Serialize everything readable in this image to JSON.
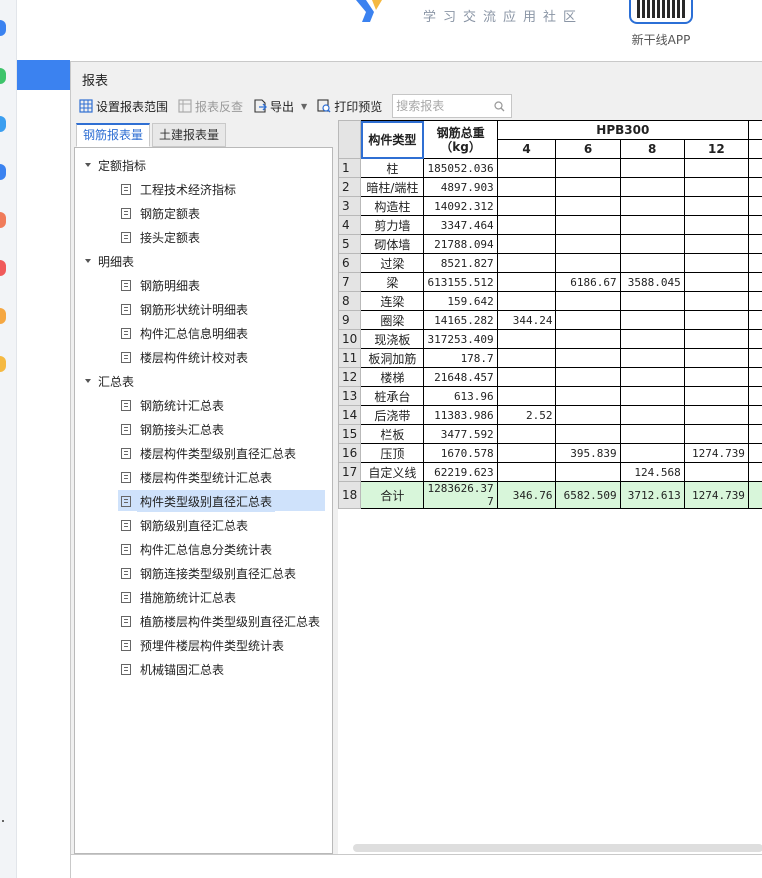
{
  "banner": {
    "slogan": "学习交流应用社区",
    "app_label": "新干线APP",
    "qr_icon": "qr-code-icon",
    "brand_color": "#2b6fd6"
  },
  "rail": {
    "icon_colors": [
      "#3b82f0",
      "#3ec46b",
      "#3b9ef0",
      "#3b82f0",
      "#f07b5a",
      "#f05a5a",
      "#f5a742",
      "#f5b942"
    ]
  },
  "window": {
    "title": "报表"
  },
  "toolbar": {
    "set_range_label": "设置报表范围",
    "reverse_label": "报表反查",
    "export_label": "导出",
    "print_label": "打印预览",
    "search_placeholder": "搜索报表"
  },
  "tabs": [
    {
      "label": "钢筋报表量"
    },
    {
      "label": "土建报表量"
    }
  ],
  "tree": {
    "groups": [
      {
        "label": "定额指标",
        "items": [
          "工程技术经济指标",
          "钢筋定额表",
          "接头定额表"
        ]
      },
      {
        "label": "明细表",
        "items": [
          "钢筋明细表",
          "钢筋形状统计明细表",
          "构件汇总信息明细表",
          "楼层构件统计校对表"
        ]
      },
      {
        "label": "汇总表",
        "items": [
          "钢筋统计汇总表",
          "钢筋接头汇总表",
          "楼层构件类型级别直径汇总表",
          "楼层构件类型统计汇总表",
          "构件类型级别直径汇总表",
          "钢筋级别直径汇总表",
          "构件汇总信息分类统计表",
          "钢筋连接类型级别直径汇总表",
          "措施筋统计汇总表",
          "植筋楼层构件类型级别直径汇总表",
          "预埋件楼层构件类型统计表",
          "机械锚固汇总表"
        ]
      }
    ],
    "selected": "构件类型级别直径汇总表"
  },
  "report": {
    "header": {
      "type_label": "构件类型",
      "weight_label": "钢筋总重",
      "weight_unit": "（kg）",
      "grade": "HPB300",
      "diameters": [
        "4",
        "6",
        "8",
        "12"
      ]
    },
    "rows": [
      {
        "no": "1",
        "name": "柱",
        "total": "185052.036",
        "d4": "",
        "d6": "",
        "d8": "",
        "d12": ""
      },
      {
        "no": "2",
        "name": "暗柱/端柱",
        "total": "4897.903",
        "d4": "",
        "d6": "",
        "d8": "",
        "d12": ""
      },
      {
        "no": "3",
        "name": "构造柱",
        "total": "14092.312",
        "d4": "",
        "d6": "",
        "d8": "",
        "d12": ""
      },
      {
        "no": "4",
        "name": "剪力墙",
        "total": "3347.464",
        "d4": "",
        "d6": "",
        "d8": "",
        "d12": ""
      },
      {
        "no": "5",
        "name": "砌体墙",
        "total": "21788.094",
        "d4": "",
        "d6": "",
        "d8": "",
        "d12": ""
      },
      {
        "no": "6",
        "name": "过梁",
        "total": "8521.827",
        "d4": "",
        "d6": "",
        "d8": "",
        "d12": ""
      },
      {
        "no": "7",
        "name": "梁",
        "total": "613155.512",
        "d4": "",
        "d6": "6186.67",
        "d8": "3588.045",
        "d12": ""
      },
      {
        "no": "8",
        "name": "连梁",
        "total": "159.642",
        "d4": "",
        "d6": "",
        "d8": "",
        "d12": ""
      },
      {
        "no": "9",
        "name": "圈梁",
        "total": "14165.282",
        "d4": "344.24",
        "d6": "",
        "d8": "",
        "d12": ""
      },
      {
        "no": "10",
        "name": "现浇板",
        "total": "317253.409",
        "d4": "",
        "d6": "",
        "d8": "",
        "d12": ""
      },
      {
        "no": "11",
        "name": "板洞加筋",
        "total": "178.7",
        "d4": "",
        "d6": "",
        "d8": "",
        "d12": ""
      },
      {
        "no": "12",
        "name": "楼梯",
        "total": "21648.457",
        "d4": "",
        "d6": "",
        "d8": "",
        "d12": ""
      },
      {
        "no": "13",
        "name": "桩承台",
        "total": "613.96",
        "d4": "",
        "d6": "",
        "d8": "",
        "d12": ""
      },
      {
        "no": "14",
        "name": "后浇带",
        "total": "11383.986",
        "d4": "2.52",
        "d6": "",
        "d8": "",
        "d12": ""
      },
      {
        "no": "15",
        "name": "栏板",
        "total": "3477.592",
        "d4": "",
        "d6": "",
        "d8": "",
        "d12": ""
      },
      {
        "no": "16",
        "name": "压顶",
        "total": "1670.578",
        "d4": "",
        "d6": "395.839",
        "d8": "",
        "d12": "1274.739"
      },
      {
        "no": "17",
        "name": "自定义线",
        "total": "62219.623",
        "d4": "",
        "d6": "",
        "d8": "124.568",
        "d12": ""
      }
    ],
    "total": {
      "no": "18",
      "name": "合计",
      "total": "1283626.377",
      "d4": "346.76",
      "d6": "6582.509",
      "d8": "3712.613",
      "d12": "1274.739"
    }
  }
}
